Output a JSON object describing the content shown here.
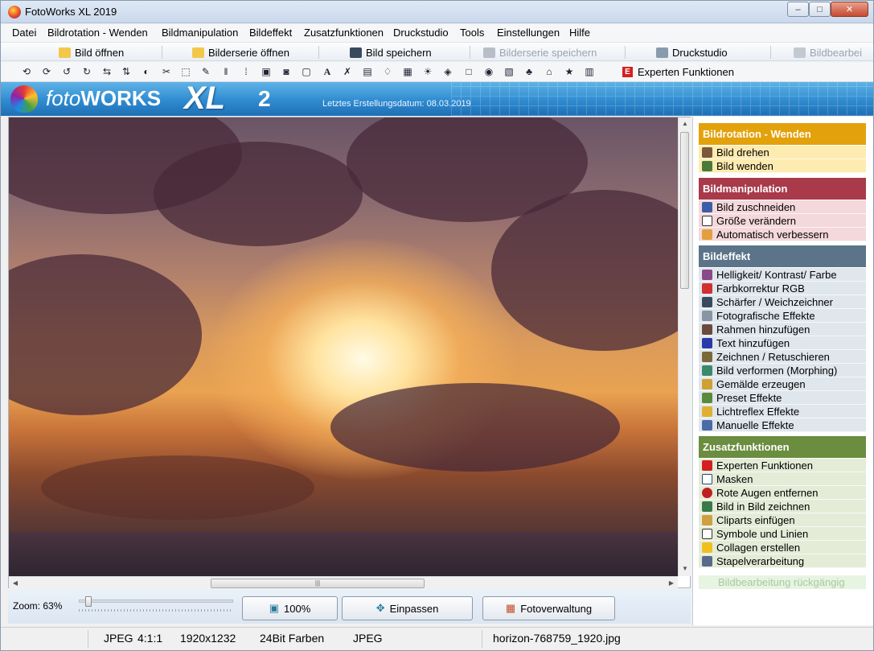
{
  "window": {
    "title": "FotoWorks XL 2019",
    "controls": [
      "–",
      "□",
      "✕"
    ]
  },
  "menu": [
    "Datei",
    "Bildrotation - Wenden",
    "Bildmanipulation",
    "Bildeffekt",
    "Zusatzfunktionen",
    "Druckstudio",
    "Tools",
    "Einstellungen",
    "Hilfe"
  ],
  "toolbar": {
    "open_image": "Bild öffnen",
    "open_series": "Bilderserie öffnen",
    "save_image": "Bild speichern",
    "save_series": "Bilderserie speichern",
    "print_studio": "Druckstudio",
    "edit_truncated": "Bildbearbei",
    "expert": "Experten Funktionen",
    "expert_icon": "E",
    "text_tool": "A"
  },
  "banner": {
    "logo_foto": "foto",
    "logo_works": "WORKS",
    "logo_xl": "XL",
    "logo_version": "2",
    "build_date": "Letztes Erstellungsdatum: 08.03.2019"
  },
  "zoom": {
    "label": "Zoom: 63%",
    "level_percent": 63,
    "btn_100": "100%",
    "btn_fit": "Einpassen",
    "btn_manager": "Fotoverwaltung"
  },
  "status": {
    "format": "JPEG",
    "subsampling": "4:1:1",
    "dimensions": "1920x1232",
    "depth": "24Bit Farben",
    "type": "JPEG",
    "filename": "horizon-768759_1920.jpg"
  },
  "panel": {
    "sections": [
      {
        "title": "Bildrotation - Wenden",
        "color": "#e3a20c",
        "bg": "#fdebb0",
        "items": [
          "Bild drehen",
          "Bild wenden"
        ]
      },
      {
        "title": "Bildmanipulation",
        "color": "#a83a4a",
        "bg": "#f4d8dc",
        "items": [
          "Bild zuschneiden",
          "Größe verändern",
          "Automatisch verbessern"
        ]
      },
      {
        "title": "Bildeffekt",
        "color": "#5b7489",
        "bg": "#dfe6ec",
        "items": [
          "Helligkeit/ Kontrast/ Farbe",
          "Farbkorrektur RGB",
          "Schärfer / Weichzeichner",
          "Fotografische Effekte",
          "Rahmen hinzufügen",
          "Text hinzufügen",
          "Zeichnen / Retuschieren",
          "Bild verformen (Morphing)",
          "Gemälde erzeugen",
          "Preset Effekte",
          "Lichtreflex Effekte",
          "Manuelle Effekte"
        ]
      },
      {
        "title": "Zusatzfunktionen",
        "color": "#6a8d3f",
        "bg": "#e4ecd8",
        "items": [
          "Experten Funktionen",
          "Masken",
          "Rote Augen entfernen",
          "Bild in Bild zeichnen",
          "Cliparts einfügen",
          "Symbole und Linien",
          "Collagen erstellen",
          "Stapelverarbeitung"
        ]
      }
    ],
    "undo": "Bildbearbeitung rückgängig"
  }
}
